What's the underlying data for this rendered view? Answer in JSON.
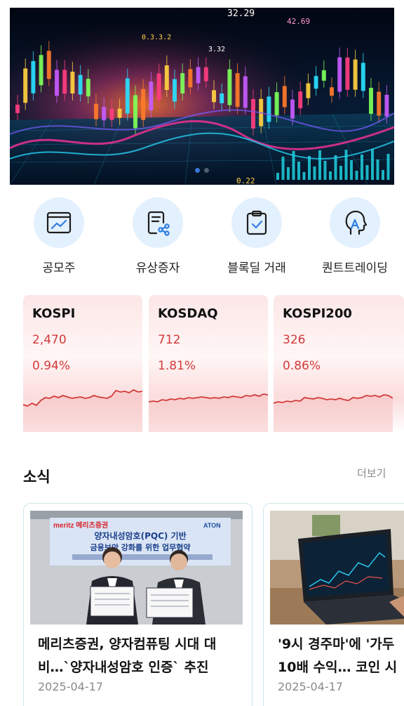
{
  "hero": {
    "description_icon": "stock-market-chart-banner",
    "banner_texts": [
      "32.29",
      "42.69",
      "0.3.3.2",
      "3.32",
      "0.22"
    ],
    "pagination": {
      "count": 2,
      "active": 0
    }
  },
  "quick_menu": [
    {
      "label": "공모주",
      "icon": "ipo-chart-icon"
    },
    {
      "label": "유상증자",
      "icon": "document-share-icon"
    },
    {
      "label": "블록딜 거래",
      "icon": "clipboard-check-icon"
    },
    {
      "label": "퀀트트레이딩",
      "icon": "ai-head-icon"
    }
  ],
  "indices": [
    {
      "name": "KOSPI",
      "value": "2,470",
      "change": "0.94%",
      "trend": [
        40,
        42,
        38,
        41,
        34,
        30,
        31,
        28,
        30,
        27,
        29,
        31,
        30,
        29,
        31,
        30,
        27,
        29,
        30,
        31,
        28,
        20,
        22,
        21,
        23,
        19,
        22,
        21
      ]
    },
    {
      "name": "KOSDAQ",
      "value": "712",
      "change": "1.81%",
      "trend": [
        36,
        35,
        36,
        33,
        34,
        32,
        33,
        31,
        32,
        30,
        31,
        30,
        29,
        30,
        31,
        30,
        31,
        29,
        30,
        28,
        29,
        30,
        27,
        28,
        26,
        28,
        25,
        26
      ]
    },
    {
      "name": "KOSPI200",
      "value": "326",
      "change": "0.86%",
      "trend": [
        38,
        36,
        37,
        35,
        36,
        34,
        35,
        30,
        31,
        32,
        30,
        31,
        33,
        32,
        33,
        31,
        33,
        34,
        30,
        31,
        30,
        27,
        28,
        27,
        29,
        26,
        27,
        31
      ]
    }
  ],
  "news": {
    "section_title": "소식",
    "more_label": "더보기",
    "items": [
      {
        "line1": "메리츠증권, 양자컴퓨팅 시대 대",
        "line2": "비…`양자내성암호 인증` 추진",
        "date": "2025-04-17",
        "image_texts": [
          "meritz 메리츠증권",
          "ATON",
          "양자내성암호(PQC) 기반",
          "금융보안 강화를 위한 업무협약"
        ]
      },
      {
        "line1": "'9시 경주마'에 '가두",
        "line2": "10배 수익… 코인 시",
        "date": "2025-04-17",
        "image_texts": []
      }
    ]
  },
  "colors": {
    "up": "#d23a3a",
    "accent_blue": "#3a77d8",
    "icon_bg": "#e3f0fd"
  }
}
